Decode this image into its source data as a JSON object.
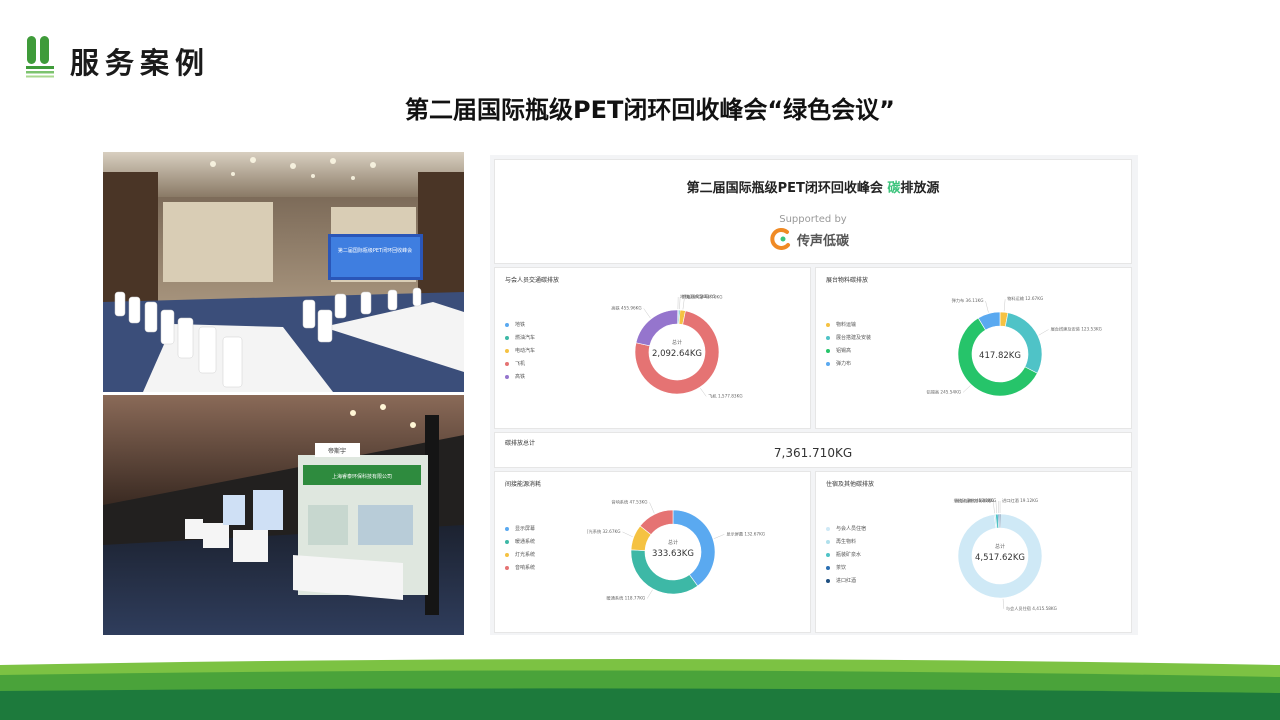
{
  "header": {
    "section_title": "服务案例",
    "main_title": "第二届国际瓶级PET闭环回收峰会“绿色会议”"
  },
  "photos": {
    "top": {
      "screen_line1": "第二届国际瓶级PET闭环回收峰会"
    },
    "bottom": {
      "banner_small": "帝斯宇",
      "banner_company": "上海睿泰环保科技有限公司"
    }
  },
  "dashboard": {
    "title_prefix": "第二届国际瓶级PET闭环回收峰会 ",
    "title_highlight": "碳",
    "title_suffix": "排放源",
    "supported_by": "Supported by",
    "brand": "传声低碳",
    "total_label": "碳排放总计",
    "total_value": "7,361.710KG",
    "colors": {
      "accent": "#3cc47c",
      "blue": "#5aa9f0",
      "teal": "#3db8a6",
      "yellow": "#f5c242",
      "red": "#e57373",
      "purple": "#9575cd",
      "green": "#26c46a",
      "cyan": "#4fc3c7"
    },
    "cards": [
      {
        "title": "与会人员交通碳排放",
        "center_label": "总计",
        "center_value": "2,092.64KG",
        "legend": [
          "地铁",
          "燃油汽车",
          "电动汽车",
          "飞机",
          "高铁"
        ],
        "legend_colors": [
          "#5aa9f0",
          "#3db8a6",
          "#f5c242",
          "#e57373",
          "#9575cd"
        ],
        "slices": [
          {
            "label": "地铁",
            "value": 14.25,
            "value_text": "14.25KG",
            "color": "#5aa9f0"
          },
          {
            "label": "燃油汽车",
            "value": 3.81,
            "value_text": "3.81KG",
            "color": "#3db8a6"
          },
          {
            "label": "电动汽车",
            "value": 43.7,
            "value_text": "43.70KG",
            "color": "#f5c242"
          },
          {
            "label": "飞机",
            "value": 1577.83,
            "value_text": "1,577.83KG",
            "color": "#e57373"
          },
          {
            "label": "高铁",
            "value": 455.96,
            "value_text": "455.96KG",
            "color": "#9575cd"
          }
        ]
      },
      {
        "title": "展台物料碳排放",
        "center_label": "",
        "center_value": "417.82KG",
        "legend": [
          "物料运输",
          "展台搭建及安装",
          "铝锡高",
          "弹力布"
        ],
        "legend_colors": [
          "#f5c242",
          "#4fc3c7",
          "#26c46a",
          "#5aa9f0"
        ],
        "slices": [
          {
            "label": "物料运输",
            "value": 12.67,
            "value_text": "12.67KG",
            "color": "#f5c242"
          },
          {
            "label": "展台搭建及安装",
            "value": 123.53,
            "value_text": "123.53KG",
            "color": "#4fc3c7"
          },
          {
            "label": "铝锡高",
            "value": 245.54,
            "value_text": "245.54KG",
            "color": "#26c46a"
          },
          {
            "label": "弹力布",
            "value": 36.11,
            "value_text": "36.11KG",
            "color": "#5aa9f0"
          }
        ]
      },
      {
        "title": "间接能源消耗",
        "center_label": "总计",
        "center_value": "333.63KG",
        "legend": [
          "显示屏幕",
          "暖通系统",
          "灯光系统",
          "音响系统"
        ],
        "legend_colors": [
          "#5aa9f0",
          "#3db8a6",
          "#f5c242",
          "#e57373"
        ],
        "slices": [
          {
            "label": "显示屏幕",
            "value": 132.67,
            "value_text": "132.67KG",
            "color": "#5aa9f0"
          },
          {
            "label": "暖通系统",
            "value": 118.77,
            "value_text": "118.77KG",
            "color": "#3db8a6"
          },
          {
            "label": "灯光系统",
            "value": 32.67,
            "value_text": "32.67KG",
            "color": "#f5c242"
          },
          {
            "label": "音响系统",
            "value": 47.53,
            "value_text": "47.53KG",
            "color": "#e57373"
          }
        ]
      },
      {
        "title": "住宿及其他碳排放",
        "center_label": "总计",
        "center_value": "4,517.62KG",
        "legend": [
          "与会人员住宿",
          "再生物料",
          "瓶装矿泉水",
          "茶饮",
          "进口红酒"
        ],
        "legend_colors": [
          "#cfe9f6",
          "#b0e0ec",
          "#4fc3c7",
          "#2b6fb3",
          "#1f4f80"
        ],
        "slices": [
          {
            "label": "与会人员住宿",
            "value": 4415.58,
            "value_text": "4,415.58KG",
            "color": "#cfe9f6"
          },
          {
            "label": "再生物料",
            "value": 23.6,
            "value_text": "23.60KG",
            "color": "#b0e0ec"
          },
          {
            "label": "瓶装矿泉水",
            "value": 46.8,
            "value_text": "46.80KG",
            "color": "#4fc3c7"
          },
          {
            "label": "茶饮",
            "value": 12.53,
            "value_text": "12.53KG",
            "color": "#2b6fb3"
          },
          {
            "label": "进口红酒",
            "value": 19.12,
            "value_text": "19.12KG",
            "color": "#1f4f80"
          }
        ]
      }
    ]
  }
}
